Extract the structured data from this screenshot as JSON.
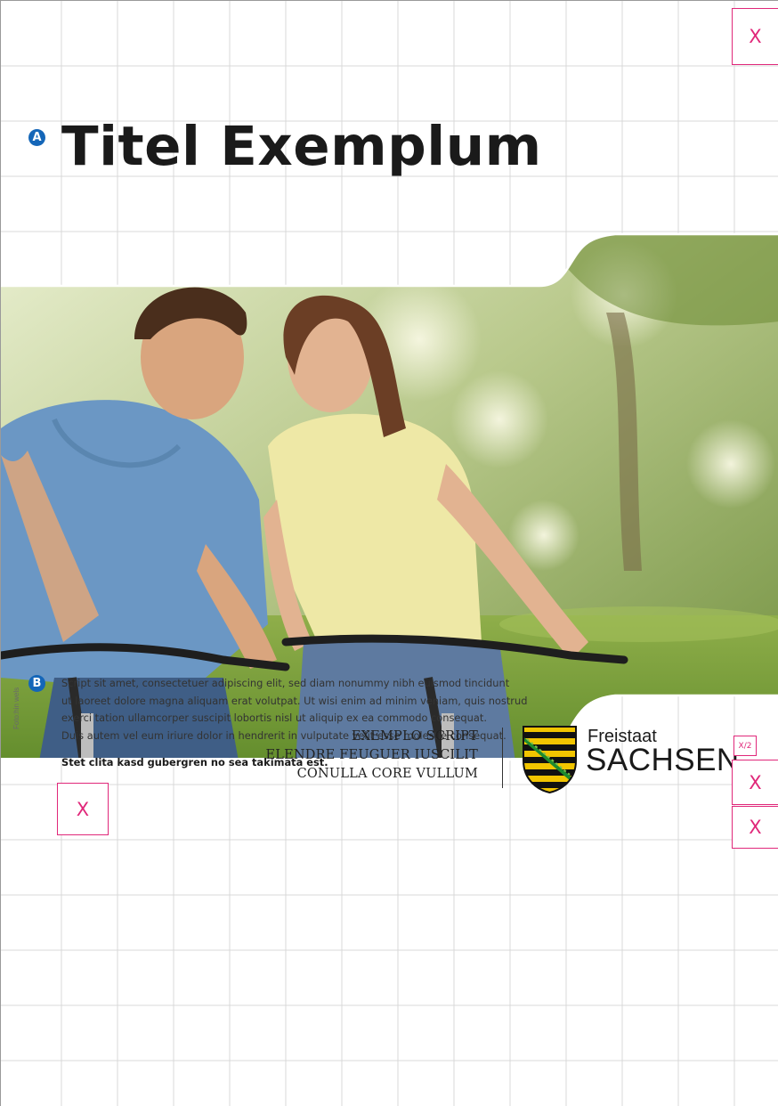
{
  "markers": {
    "a": "A",
    "b": "B"
  },
  "title": "Titel Exemplum",
  "photo": {
    "credit": "Foto:hin wels"
  },
  "body_text": {
    "lines": [
      "Script sit amet, consectetuer adipiscing elit, sed diam nonummy nibh euismod tincidunt",
      "ut laoreet dolore magna aliquam erat volutpat. Ut wisi enim ad minim veniam, quis nostrud",
      "exerci tation ullamcorper suscipit lobortis nisl ut aliquip ex ea commodo consequat.",
      "Duis autem vel eum iriure dolor in hendrerit in vulputate velit esse molestie consequat."
    ],
    "lead": "Stet clita kasd gubergren no sea takimata est."
  },
  "address": [
    "EXEMPLO SCRIPT",
    "ELENDRE FEUGUER IUSCILIT",
    "CONULLA CORE VULLUM"
  ],
  "logo": {
    "line1": "Freistaat",
    "line2": "SACHSEN"
  },
  "placeholders": {
    "x": "X",
    "fraction": "X/2"
  },
  "colors": {
    "accent": "#e0287a",
    "marker": "#1466b8",
    "grid": "#d9d9d9"
  }
}
